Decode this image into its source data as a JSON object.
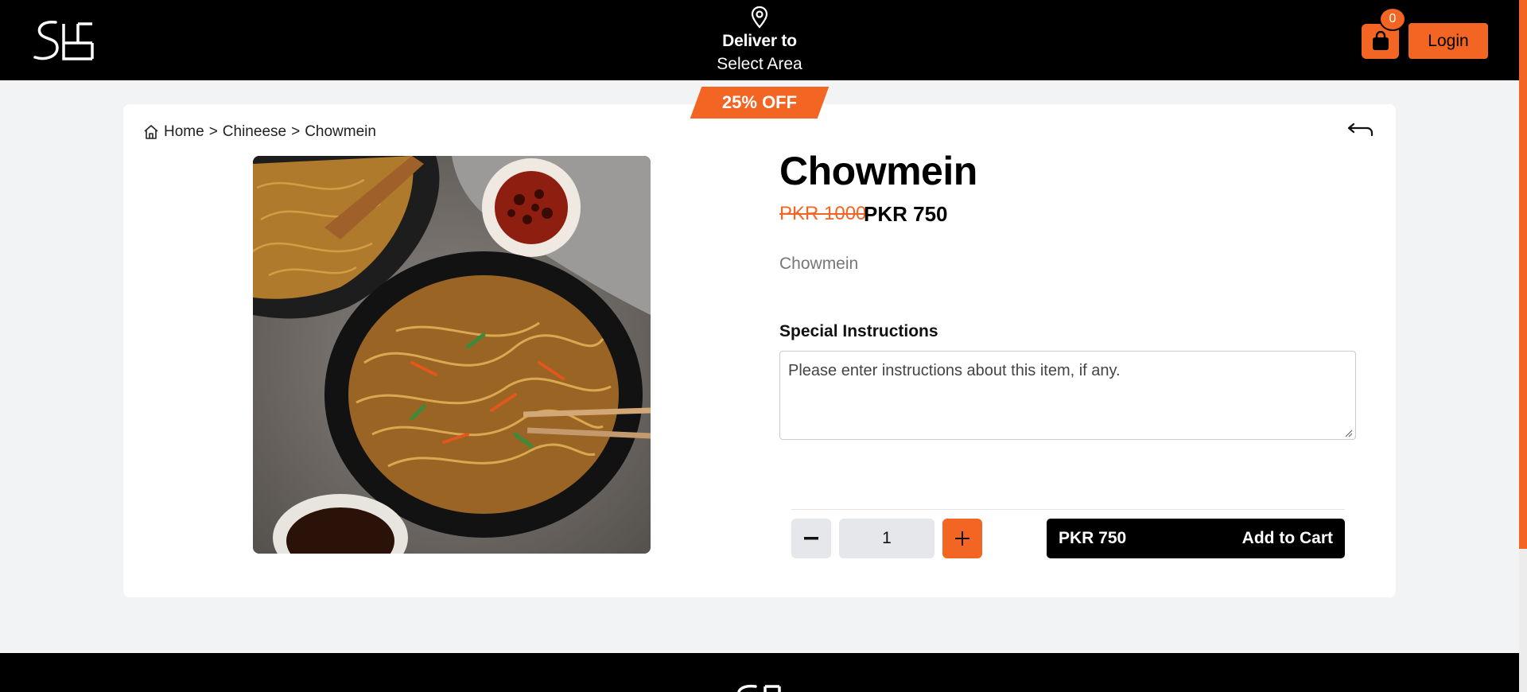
{
  "header": {
    "deliver_label": "Deliver to",
    "deliver_area": "Select Area",
    "cart_count": "0",
    "login_label": "Login"
  },
  "product": {
    "discount_badge": "25% OFF",
    "title": "Chowmein",
    "old_price": "PKR 1000",
    "new_price": "PKR 750",
    "description": "Chowmein",
    "special_instructions_label": "Special Instructions",
    "special_instructions_placeholder": "Please enter instructions about this item, if any.",
    "quantity": "1",
    "cart_price": "PKR 750",
    "add_to_cart_label": "Add to Cart"
  },
  "breadcrumb": {
    "home": "Home",
    "category": "Chineese",
    "current": "Chowmein",
    "separator": ">"
  },
  "colors": {
    "accent": "#f26522",
    "header_bg": "#000000",
    "page_bg": "#f2f3f5"
  },
  "icons": [
    "map-pin-icon",
    "shopping-bag-icon",
    "home-icon",
    "back-arrow-icon",
    "minus-icon",
    "plus-icon"
  ]
}
